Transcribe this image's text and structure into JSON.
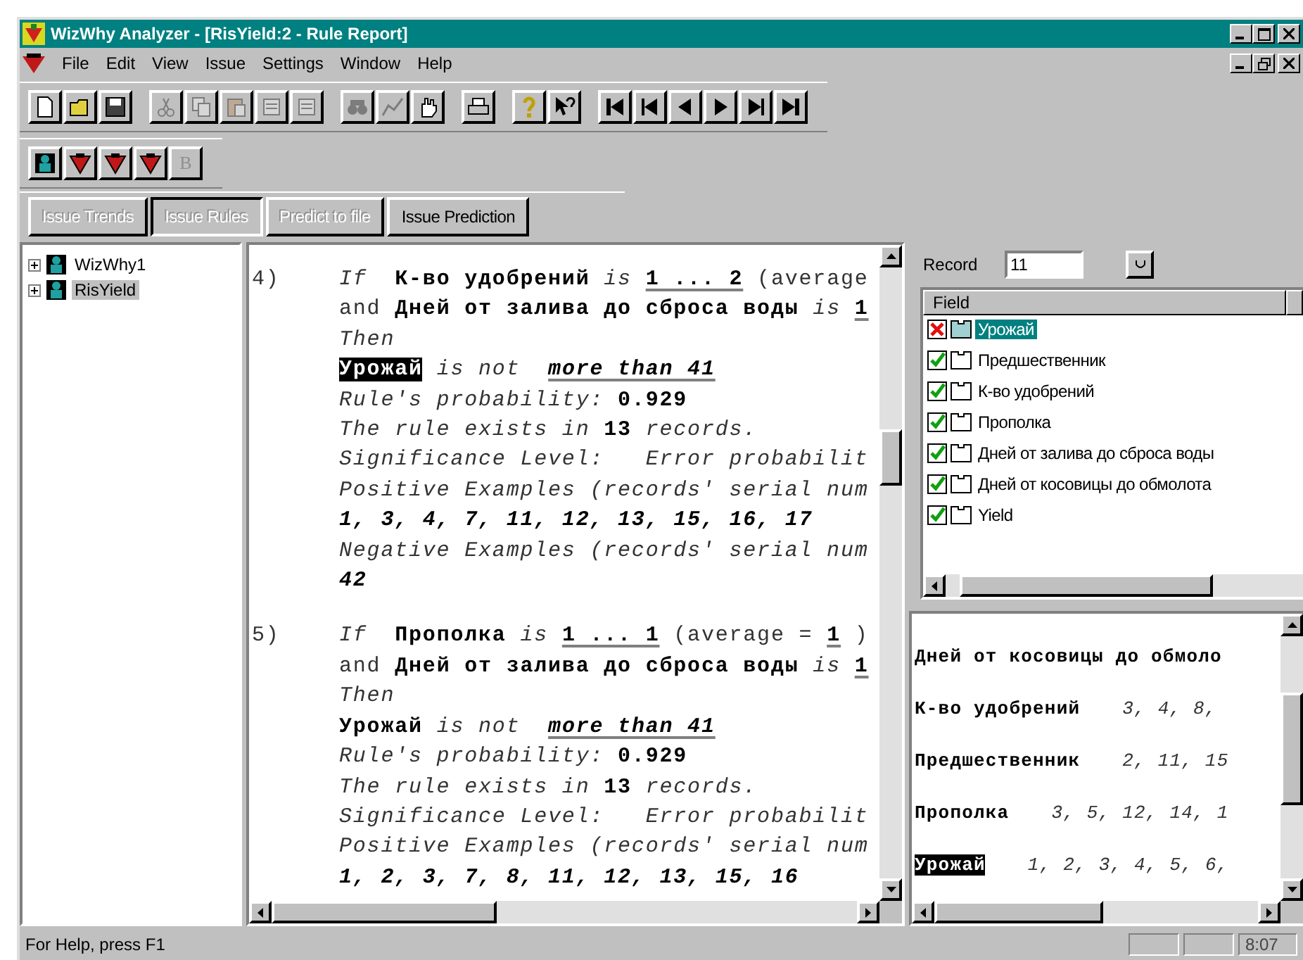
{
  "window": {
    "title": "WizWhy Analyzer - [RisYield:2 - Rule Report]"
  },
  "menu": [
    "File",
    "Edit",
    "View",
    "Issue",
    "Settings",
    "Window",
    "Help"
  ],
  "toolbar": [
    {
      "kind": "new",
      "disabled": false
    },
    {
      "kind": "open",
      "disabled": false
    },
    {
      "kind": "save",
      "disabled": false
    },
    {
      "kind": "sep"
    },
    {
      "kind": "cut",
      "disabled": true
    },
    {
      "kind": "copy",
      "disabled": true
    },
    {
      "kind": "paste",
      "disabled": true
    },
    {
      "kind": "page",
      "disabled": true
    },
    {
      "kind": "page",
      "disabled": true
    },
    {
      "kind": "sep"
    },
    {
      "kind": "find",
      "disabled": true
    },
    {
      "kind": "chart",
      "disabled": true
    },
    {
      "kind": "hand",
      "disabled": false
    },
    {
      "kind": "sep"
    },
    {
      "kind": "print",
      "disabled": false
    },
    {
      "kind": "sep"
    },
    {
      "kind": "help",
      "disabled": false
    },
    {
      "kind": "context-help",
      "disabled": false
    },
    {
      "kind": "sep"
    },
    {
      "kind": "first",
      "disabled": false
    },
    {
      "kind": "prev-page",
      "disabled": false
    },
    {
      "kind": "prev",
      "disabled": false
    },
    {
      "kind": "next",
      "disabled": false
    },
    {
      "kind": "next-page",
      "disabled": false
    },
    {
      "kind": "last",
      "disabled": false
    }
  ],
  "toolbar2": [
    {
      "kind": "person",
      "disabled": false
    },
    {
      "kind": "marker",
      "disabled": false
    },
    {
      "kind": "marker",
      "disabled": false
    },
    {
      "kind": "marker",
      "disabled": false
    },
    {
      "kind": "text",
      "label": "B",
      "disabled": true
    }
  ],
  "action_buttons": [
    {
      "label": "Issue Trends",
      "disabled": true,
      "pressed": false
    },
    {
      "label": "Issue Rules",
      "disabled": true,
      "pressed": true
    },
    {
      "label": "Predict to file",
      "disabled": true,
      "pressed": false
    },
    {
      "label": "Issue Prediction",
      "disabled": false,
      "pressed": false
    }
  ],
  "tree": [
    {
      "label": "WizWhy1",
      "selected": false
    },
    {
      "label": "RisYield",
      "selected": true
    }
  ],
  "report": [
    {
      "number": "4)",
      "lines": [
        [
          {
            "kind": "italic",
            "text": "If  "
          },
          {
            "kind": "bold",
            "text": "К-во удобрений"
          },
          {
            "kind": "italic",
            "text": " is "
          },
          {
            "kind": "underline",
            "text": "1 ... 2"
          },
          {
            "kind": "plain",
            "text": " (average"
          }
        ],
        [
          {
            "kind": "plain",
            "text": "and "
          },
          {
            "kind": "bold",
            "text": "Дней от залива до сброса воды"
          },
          {
            "kind": "italic",
            "text": " is "
          },
          {
            "kind": "underline",
            "text": "1"
          }
        ],
        [
          {
            "kind": "italic",
            "text": "Then"
          }
        ],
        [
          {
            "kind": "highlight",
            "text": "Урожай"
          },
          {
            "kind": "italic",
            "text": " is not  "
          },
          {
            "kind": "underline-italic",
            "text": "more than 41"
          }
        ],
        [
          {
            "kind": "italic",
            "text": "Rule's probability: "
          },
          {
            "kind": "bold",
            "text": "0.929"
          }
        ],
        [
          {
            "kind": "italic",
            "text": "The rule exists in "
          },
          {
            "kind": "bold",
            "text": "13"
          },
          {
            "kind": "italic",
            "text": " records."
          }
        ],
        [
          {
            "kind": "italic",
            "text": "Significance Level:   Error probabilit"
          }
        ],
        [
          {
            "kind": "italic",
            "text": "Positive Examples (records' serial num"
          }
        ],
        [
          {
            "kind": "bold-italic",
            "text": "1, 3, 4, 7, 11, 12, 13, 15, 16, 17"
          }
        ],
        [
          {
            "kind": "italic",
            "text": "Negative Examples (records' serial num"
          }
        ],
        [
          {
            "kind": "bold-italic",
            "text": "42"
          }
        ]
      ]
    },
    {
      "number": "5)",
      "lines": [
        [
          {
            "kind": "italic",
            "text": "If  "
          },
          {
            "kind": "bold",
            "text": "Прополка"
          },
          {
            "kind": "italic",
            "text": " is "
          },
          {
            "kind": "underline",
            "text": "1 ... 1"
          },
          {
            "kind": "plain",
            "text": " (average = "
          },
          {
            "kind": "underline",
            "text": "1"
          },
          {
            "kind": "plain",
            "text": " )"
          }
        ],
        [
          {
            "kind": "plain",
            "text": "and "
          },
          {
            "kind": "bold",
            "text": "Дней от залива до сброса воды"
          },
          {
            "kind": "italic",
            "text": " is "
          },
          {
            "kind": "underline",
            "text": "1"
          }
        ],
        [
          {
            "kind": "italic",
            "text": "Then"
          }
        ],
        [
          {
            "kind": "bold",
            "text": "Урожай"
          },
          {
            "kind": "italic",
            "text": " is not  "
          },
          {
            "kind": "underline-italic",
            "text": "more than 41"
          }
        ],
        [
          {
            "kind": "italic",
            "text": "Rule's probability: "
          },
          {
            "kind": "bold",
            "text": "0.929"
          }
        ],
        [
          {
            "kind": "italic",
            "text": "The rule exists in "
          },
          {
            "kind": "bold",
            "text": "13"
          },
          {
            "kind": "italic",
            "text": " records."
          }
        ],
        [
          {
            "kind": "italic",
            "text": "Significance Level:   Error probabilit"
          }
        ],
        [
          {
            "kind": "italic",
            "text": "Positive Examples (records' serial num"
          }
        ],
        [
          {
            "kind": "bold-italic",
            "text": "1, 2, 3, 7, 8, 11, 12, 13, 15, 16"
          }
        ]
      ]
    }
  ],
  "record": {
    "label": "Record",
    "value": "11"
  },
  "fields": {
    "header": "Field",
    "items": [
      {
        "label": "Урожай",
        "checked": false,
        "selected": true
      },
      {
        "label": "Предшественник",
        "checked": true,
        "selected": false
      },
      {
        "label": "К-во удобрений",
        "checked": true,
        "selected": false
      },
      {
        "label": "Прополка",
        "checked": true,
        "selected": false
      },
      {
        "label": "Дней от залива до сброса воды",
        "checked": true,
        "selected": false
      },
      {
        "label": "Дней от косовицы до обмолота",
        "checked": true,
        "selected": false
      },
      {
        "label": "Yield",
        "checked": true,
        "selected": false
      }
    ]
  },
  "summary": [
    {
      "name": "Дней от косовицы до обмоло",
      "highlighted": false
    },
    {
      "name": "К-во удобрений",
      "records": "3, 4, 8,",
      "highlighted": false
    },
    {
      "name": "Предшественник",
      "records": "2, 11, 15",
      "highlighted": false
    },
    {
      "name": "Прополка",
      "records": "3, 5, 12, 14, 1",
      "highlighted": false
    },
    {
      "name": "Урожай",
      "records": "1, 2, 3, 4, 5, 6,",
      "highlighted": true
    }
  ],
  "status_bar": {
    "text": "For Help, press F1",
    "time": "8:07"
  }
}
